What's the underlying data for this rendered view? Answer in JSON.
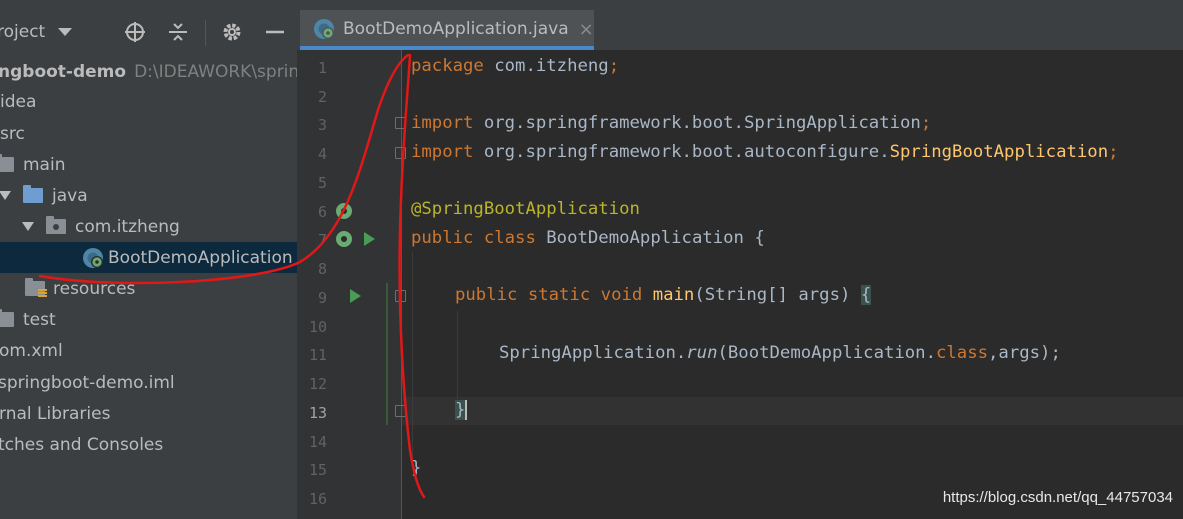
{
  "project_panel": {
    "title": "roject",
    "tree": [
      {
        "label": "ngboot-demo",
        "path": "D:\\IDEAWORK\\spring",
        "bold": true
      },
      {
        "label": "idea"
      },
      {
        "label": "src"
      },
      {
        "label": "main"
      },
      {
        "label": "java"
      },
      {
        "label": "com.itzheng"
      },
      {
        "label": "BootDemoApplication",
        "selected": true
      },
      {
        "label": "resources"
      },
      {
        "label": "test"
      },
      {
        "label": "om.xml"
      },
      {
        "label": "springboot-demo.iml"
      },
      {
        "label": "rnal Libraries"
      },
      {
        "label": "tches and Consoles"
      }
    ]
  },
  "editor": {
    "tab_label": "BootDemoApplication.java",
    "tab_close": "×",
    "current_line": 13,
    "line_numbers": [
      "1",
      "2",
      "3",
      "4",
      "5",
      "6",
      "7",
      "8",
      "9",
      "10",
      "11",
      "12",
      "13",
      "14",
      "15",
      "16"
    ],
    "code": {
      "l1_kw": "package",
      "l1_rest": " com.itzheng",
      "l1_semi": ";",
      "l3_kw": "import",
      "l3_rest": " org.springframework.boot.SpringApplication",
      "l3_semi": ";",
      "l4_kw": "import",
      "l4_rest": " org.springframework.boot.autoconfigure.",
      "l4_cls": "SpringBootApplication",
      "l4_semi": ";",
      "l6_ann": "@SpringBootApplication",
      "l7_kw1": "public",
      "l7_kw2": "class",
      "l7_rest": " BootDemoApplication {",
      "l9_kw": "public static void",
      "l9_fn": "main",
      "l9_rest": "(String[] args) ",
      "l9_brace": "{",
      "l11_a": "SpringApplication.",
      "l11_run": "run",
      "l11_b": "(BootDemoApplication.",
      "l11_kw": "class",
      "l11_c": ",args);",
      "l13": "}",
      "l15": "}"
    }
  },
  "watermark": "https://blog.csdn.net/qq_44757034",
  "colors": {
    "keyword": "#cc7832",
    "annotation": "#bbb529",
    "function": "#ffc66d",
    "text": "#a9b7c6",
    "drawing": "#e01818"
  }
}
